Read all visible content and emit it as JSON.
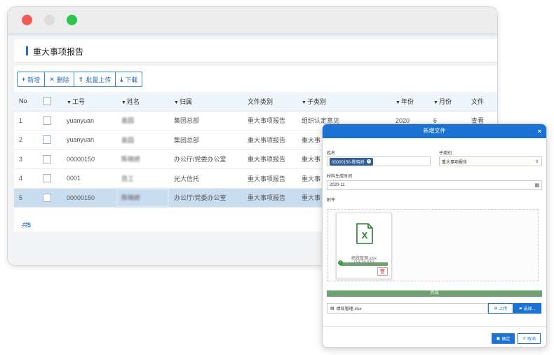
{
  "page": {
    "title": "重大事项报告"
  },
  "toolbar": {
    "add": "新增",
    "delete": "删除",
    "batch_upload": "批量上传",
    "download": "下载"
  },
  "table": {
    "headers": [
      "No",
      "",
      "工号",
      "姓名",
      "归属",
      "文件类别",
      "子类别",
      "年份",
      "月份",
      "文件"
    ],
    "rows": [
      {
        "no": "1",
        "id": "yuanyuan",
        "name": "袁园",
        "org": "集团总部",
        "type": "重大事项报告",
        "sub": "组织认定意见",
        "year": "2020",
        "month": "6",
        "file": "查看"
      },
      {
        "no": "2",
        "id": "yuanyuan",
        "name": "袁园",
        "org": "集团总部",
        "type": "重大事项报告",
        "sub": "重大事",
        "year": "",
        "month": "",
        "file": ""
      },
      {
        "no": "3",
        "id": "00000150",
        "name": "陈晓娇",
        "org": "办公厅/党委办公室",
        "type": "重大事项报告",
        "sub": "重大事",
        "year": "",
        "month": "",
        "file": ""
      },
      {
        "no": "4",
        "id": "0001",
        "name": "员工",
        "org": "光大信托",
        "type": "重大事项报告",
        "sub": "重大事",
        "year": "",
        "month": "",
        "file": ""
      },
      {
        "no": "5",
        "id": "00000150",
        "name": "陈晓娇",
        "org": "办公厅/党委办公室",
        "type": "重大事项报告",
        "sub": "重大事",
        "year": "",
        "month": "",
        "file": ""
      }
    ],
    "total_prefix": "共",
    "total_count": "5"
  },
  "modal": {
    "title": "新增文件",
    "close": "×",
    "name_label": "姓名",
    "name_tag": "00000150-陈晓娇",
    "subcat_label": "子类别",
    "subcat_value": "重大事项报告",
    "date_label": "材料生成时间",
    "date_value": "2020-11",
    "attach_label": "附件",
    "file_name": "绩效管理.xlsx",
    "file_size": "(14.38 KB)",
    "done_text": "完成",
    "upload_field_value": "绩效管理.xlsx",
    "upload_btn": "上传",
    "choose_btn": "选择...",
    "ok_btn": "确定",
    "cancel_btn": "取消"
  }
}
